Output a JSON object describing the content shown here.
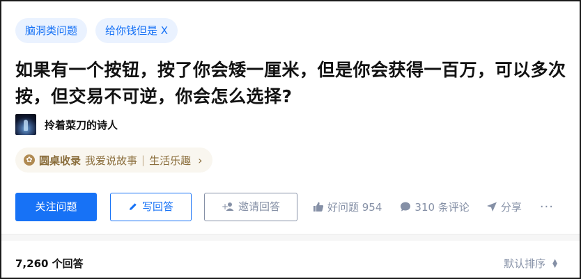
{
  "topics": [
    "脑洞类问题",
    "给你钱但是 X"
  ],
  "question": {
    "title": "如果有一个按钮，按了你会矮一厘米，但是你会获得一百万，可以多次按，但交易不可逆，你会怎么选择?"
  },
  "author": {
    "name": "拎着菜刀的诗人"
  },
  "collection": {
    "icon": "roundtable-icon",
    "name": "圆桌收录",
    "items": [
      "我爱说故事",
      "生活乐趣"
    ],
    "separator": "|"
  },
  "actions": {
    "follow_label": "关注问题",
    "write_label": "写回答",
    "invite_label": "邀请回答",
    "like_label": "好问题 954",
    "comment_label": "310 条评论",
    "share_label": "分享",
    "more_label": "···"
  },
  "answers": {
    "count_label": "7,260 个回答",
    "sort_label": "默认排序"
  },
  "colors": {
    "accent": "#1772f6",
    "tag_bg": "#eaf2ff",
    "muted": "#8590a6",
    "collection_text": "#8a6d3b",
    "collection_bg": "#f9f6ef"
  }
}
